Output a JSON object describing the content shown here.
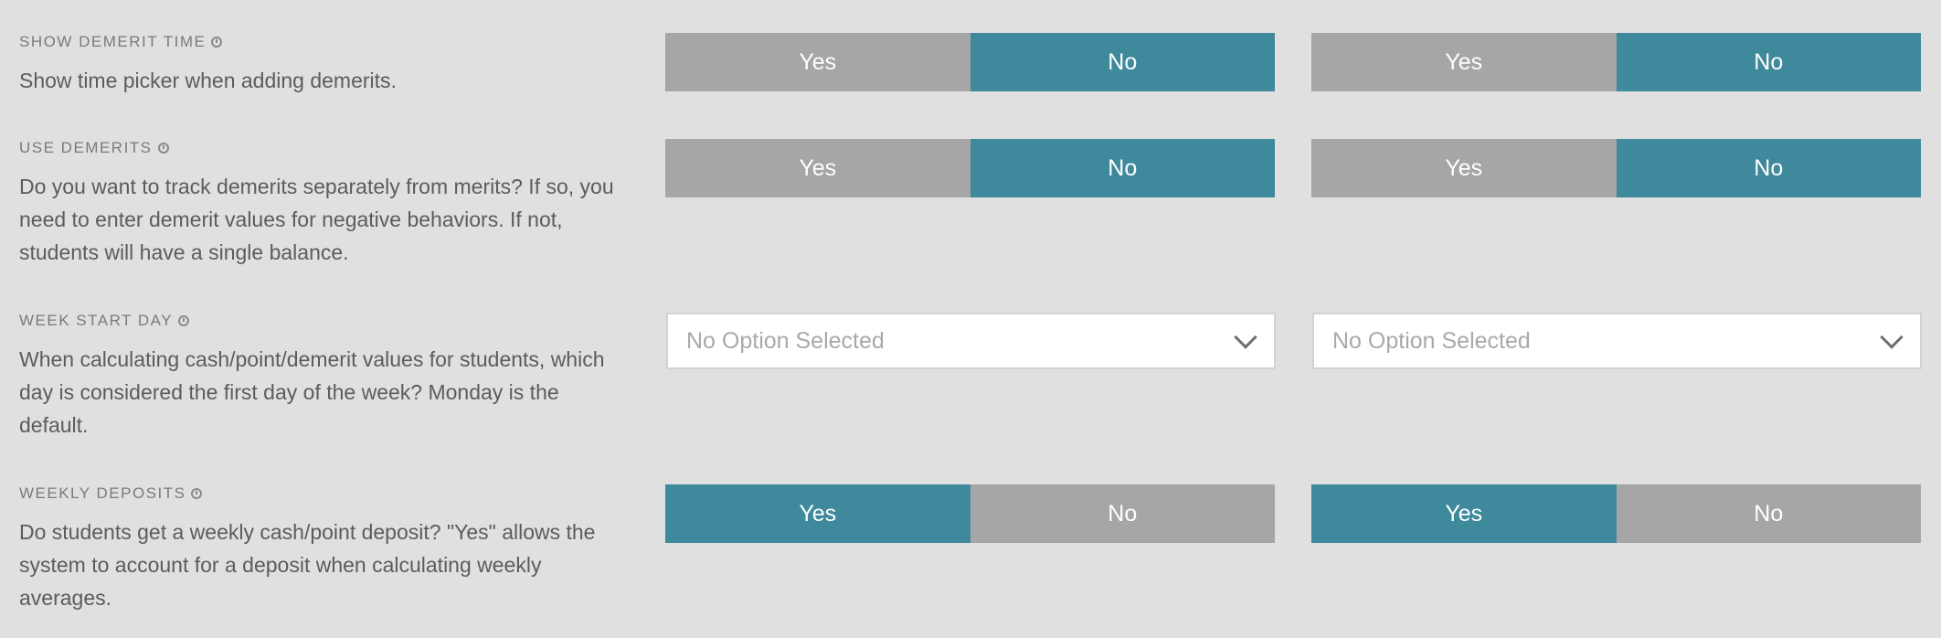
{
  "settings": [
    {
      "title": "SHOW DEMERIT TIME",
      "description": "Show time picker when adding demerits.",
      "control": "toggle",
      "left": {
        "yes": "Yes",
        "no": "No",
        "selected": "No"
      },
      "right": {
        "yes": "Yes",
        "no": "No",
        "selected": "No"
      }
    },
    {
      "title": "USE DEMERITS",
      "description": "Do you want to track demerits separately from merits? If so, you need to enter demerit values for negative behaviors. If not, students will have a single balance.",
      "control": "toggle",
      "left": {
        "yes": "Yes",
        "no": "No",
        "selected": "No"
      },
      "right": {
        "yes": "Yes",
        "no": "No",
        "selected": "No"
      }
    },
    {
      "title": "WEEK START DAY",
      "description": "When calculating cash/point/demerit values for students, which day is considered the first day of the week? Monday is the default.",
      "control": "select",
      "left": {
        "value": "No Option Selected"
      },
      "right": {
        "value": "No Option Selected"
      }
    },
    {
      "title": "WEEKLY DEPOSITS",
      "description": "Do students get a weekly cash/point deposit? \"Yes\" allows the system to account for a deposit when calculating weekly averages.",
      "control": "toggle",
      "left": {
        "yes": "Yes",
        "no": "No",
        "selected": "Yes"
      },
      "right": {
        "yes": "Yes",
        "no": "No",
        "selected": "Yes"
      }
    }
  ],
  "colors": {
    "background": "#e0e0e0",
    "active": "#3f899c",
    "inactive": "#a6a6a6"
  },
  "icons": {
    "info": "info-icon",
    "dropdown": "chevron-down-icon"
  }
}
